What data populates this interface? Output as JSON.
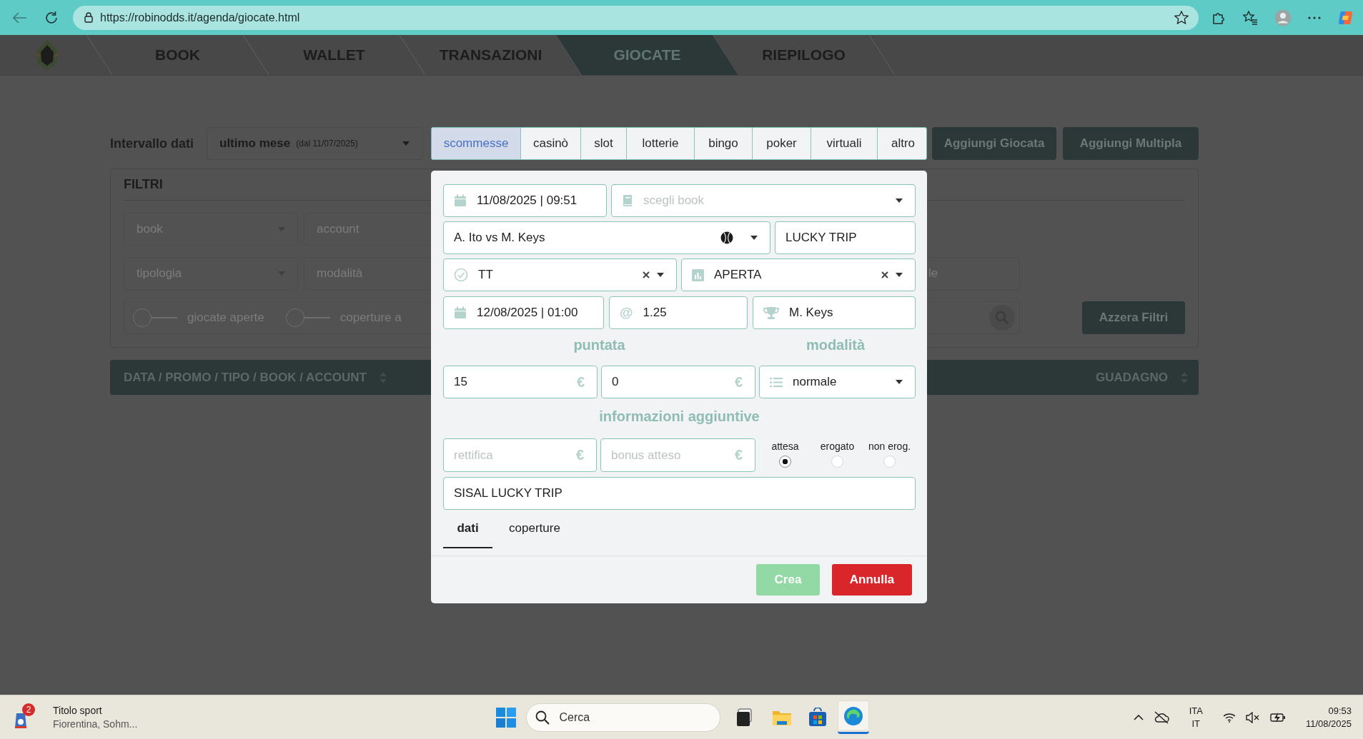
{
  "browser": {
    "url": "https://robinodds.it/agenda/giocate.html"
  },
  "nav": {
    "items": [
      {
        "label": "BOOK",
        "selected": false
      },
      {
        "label": "WALLET",
        "selected": false
      },
      {
        "label": "TRANSAZIONI",
        "selected": false
      },
      {
        "label": "GIOCATE",
        "selected": true
      },
      {
        "label": "RIEPILOGO",
        "selected": false
      }
    ]
  },
  "toolbar": {
    "range_label": "Intervallo dati",
    "range_select": {
      "value": "ultimo mese",
      "note": "(dal 11/07/2025)"
    },
    "categories": [
      {
        "label": "scommesse",
        "selected": true
      },
      {
        "label": "casinò",
        "selected": false
      },
      {
        "label": "slot",
        "selected": false
      },
      {
        "label": "lotterie",
        "selected": false
      },
      {
        "label": "bingo",
        "selected": false
      },
      {
        "label": "poker",
        "selected": false
      },
      {
        "label": "virtuali",
        "selected": false
      },
      {
        "label": "altro",
        "selected": false
      }
    ],
    "buttons": [
      "Aggiungi Giocata",
      "Aggiungi Multipla"
    ]
  },
  "filters": {
    "title": "FILTRI",
    "fields": [
      {
        "kind": "select",
        "placeholder": "book"
      },
      {
        "kind": "input",
        "placeholder": "account"
      },
      {
        "kind": "select",
        "placeholder": "tipologia"
      },
      {
        "kind": "input",
        "placeholder": "modalità"
      }
    ],
    "toggles": [
      {
        "label": "giocate aperte",
        "on": false
      },
      {
        "label": "coperture a",
        "on": false
      }
    ],
    "right_field": {
      "placeholder": "le"
    },
    "reset_button": "Azzera Filtri"
  },
  "table": {
    "columns": [
      {
        "label": "DATA / PROMO / TIPO / BOOK / ACCOUNT"
      },
      {
        "label": "GUADAGNO"
      }
    ]
  },
  "modal": {
    "fields": [
      {
        "kind": "date",
        "value": "11/08/2025 | 09:51"
      },
      {
        "kind": "book-select",
        "placeholder": "scegli book"
      },
      {
        "kind": "event",
        "value": "A. Ito vs M. Keys"
      },
      {
        "kind": "text",
        "value": "LUCKY TRIP"
      },
      {
        "kind": "type-select",
        "value": "TT"
      },
      {
        "kind": "status-select",
        "value": "APERTA"
      },
      {
        "kind": "date",
        "value": "12/08/2025 | 01:00"
      },
      {
        "kind": "odds",
        "prefix": "@",
        "value": "1.25"
      },
      {
        "kind": "winner",
        "value": "M. Keys"
      }
    ],
    "stake_label": "puntata",
    "mode_label": "modalità",
    "stake_fields": [
      {
        "value": "15",
        "suffix": "€"
      },
      {
        "value": "0",
        "suffix": "€"
      }
    ],
    "mode_select": {
      "value": "normale"
    },
    "extra_label": "informazioni aggiuntive",
    "extra_fields": [
      {
        "placeholder": "rettifica",
        "suffix": "€"
      },
      {
        "placeholder": "bonus atteso",
        "suffix": "€"
      }
    ],
    "bonus_status": [
      {
        "label": "attesa",
        "selected": true
      },
      {
        "label": "erogato",
        "selected": false
      },
      {
        "label": "non erog.",
        "selected": false
      }
    ],
    "notes": {
      "value": "SISAL LUCKY TRIP"
    },
    "tabs": [
      {
        "label": "dati",
        "selected": true
      },
      {
        "label": "coperture",
        "selected": false
      }
    ],
    "buttons": [
      {
        "label": "Crea",
        "kind": "primary",
        "disabled": true
      },
      {
        "label": "Annulla",
        "kind": "danger",
        "disabled": false
      }
    ]
  },
  "taskbar": {
    "widget": {
      "badge": "2",
      "title": "Titolo sport",
      "subtitle": "Fiorentina, Sohm..."
    },
    "search": {
      "placeholder": "Cerca"
    },
    "apps": [
      {
        "kind": "task-view",
        "selected": false
      },
      {
        "kind": "files",
        "selected": false
      },
      {
        "kind": "store",
        "selected": false
      },
      {
        "kind": "browser",
        "selected": true
      }
    ],
    "language": {
      "top": "ITA",
      "bottom": "IT"
    },
    "clock": {
      "time": "09:53",
      "date": "11/08/2025"
    }
  }
}
